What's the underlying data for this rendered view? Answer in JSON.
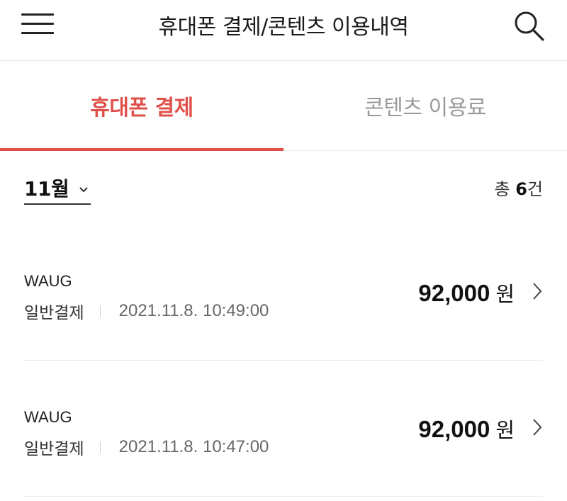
{
  "header": {
    "title": "휴대폰 결제/콘텐츠 이용내역",
    "menu_icon": "hamburger-menu-icon",
    "search_icon": "search-icon"
  },
  "tabs": [
    {
      "label": "휴대폰 결제",
      "active": true
    },
    {
      "label": "콘텐츠 이용료",
      "active": false
    }
  ],
  "filter": {
    "month": "11월",
    "count_prefix": "총",
    "count_value": "6",
    "count_suffix": "건"
  },
  "transactions": [
    {
      "merchant": "WAUG",
      "type": "일반결제",
      "datetime": "2021.11.8. 10:49:00",
      "amount": "92,000",
      "unit": "원"
    },
    {
      "merchant": "WAUG",
      "type": "일반결제",
      "datetime": "2021.11.8. 10:47:00",
      "amount": "92,000",
      "unit": "원"
    }
  ],
  "colors": {
    "accent": "#e0504a",
    "inactive_tab": "#9a9a9a",
    "divider": "#ececec"
  }
}
